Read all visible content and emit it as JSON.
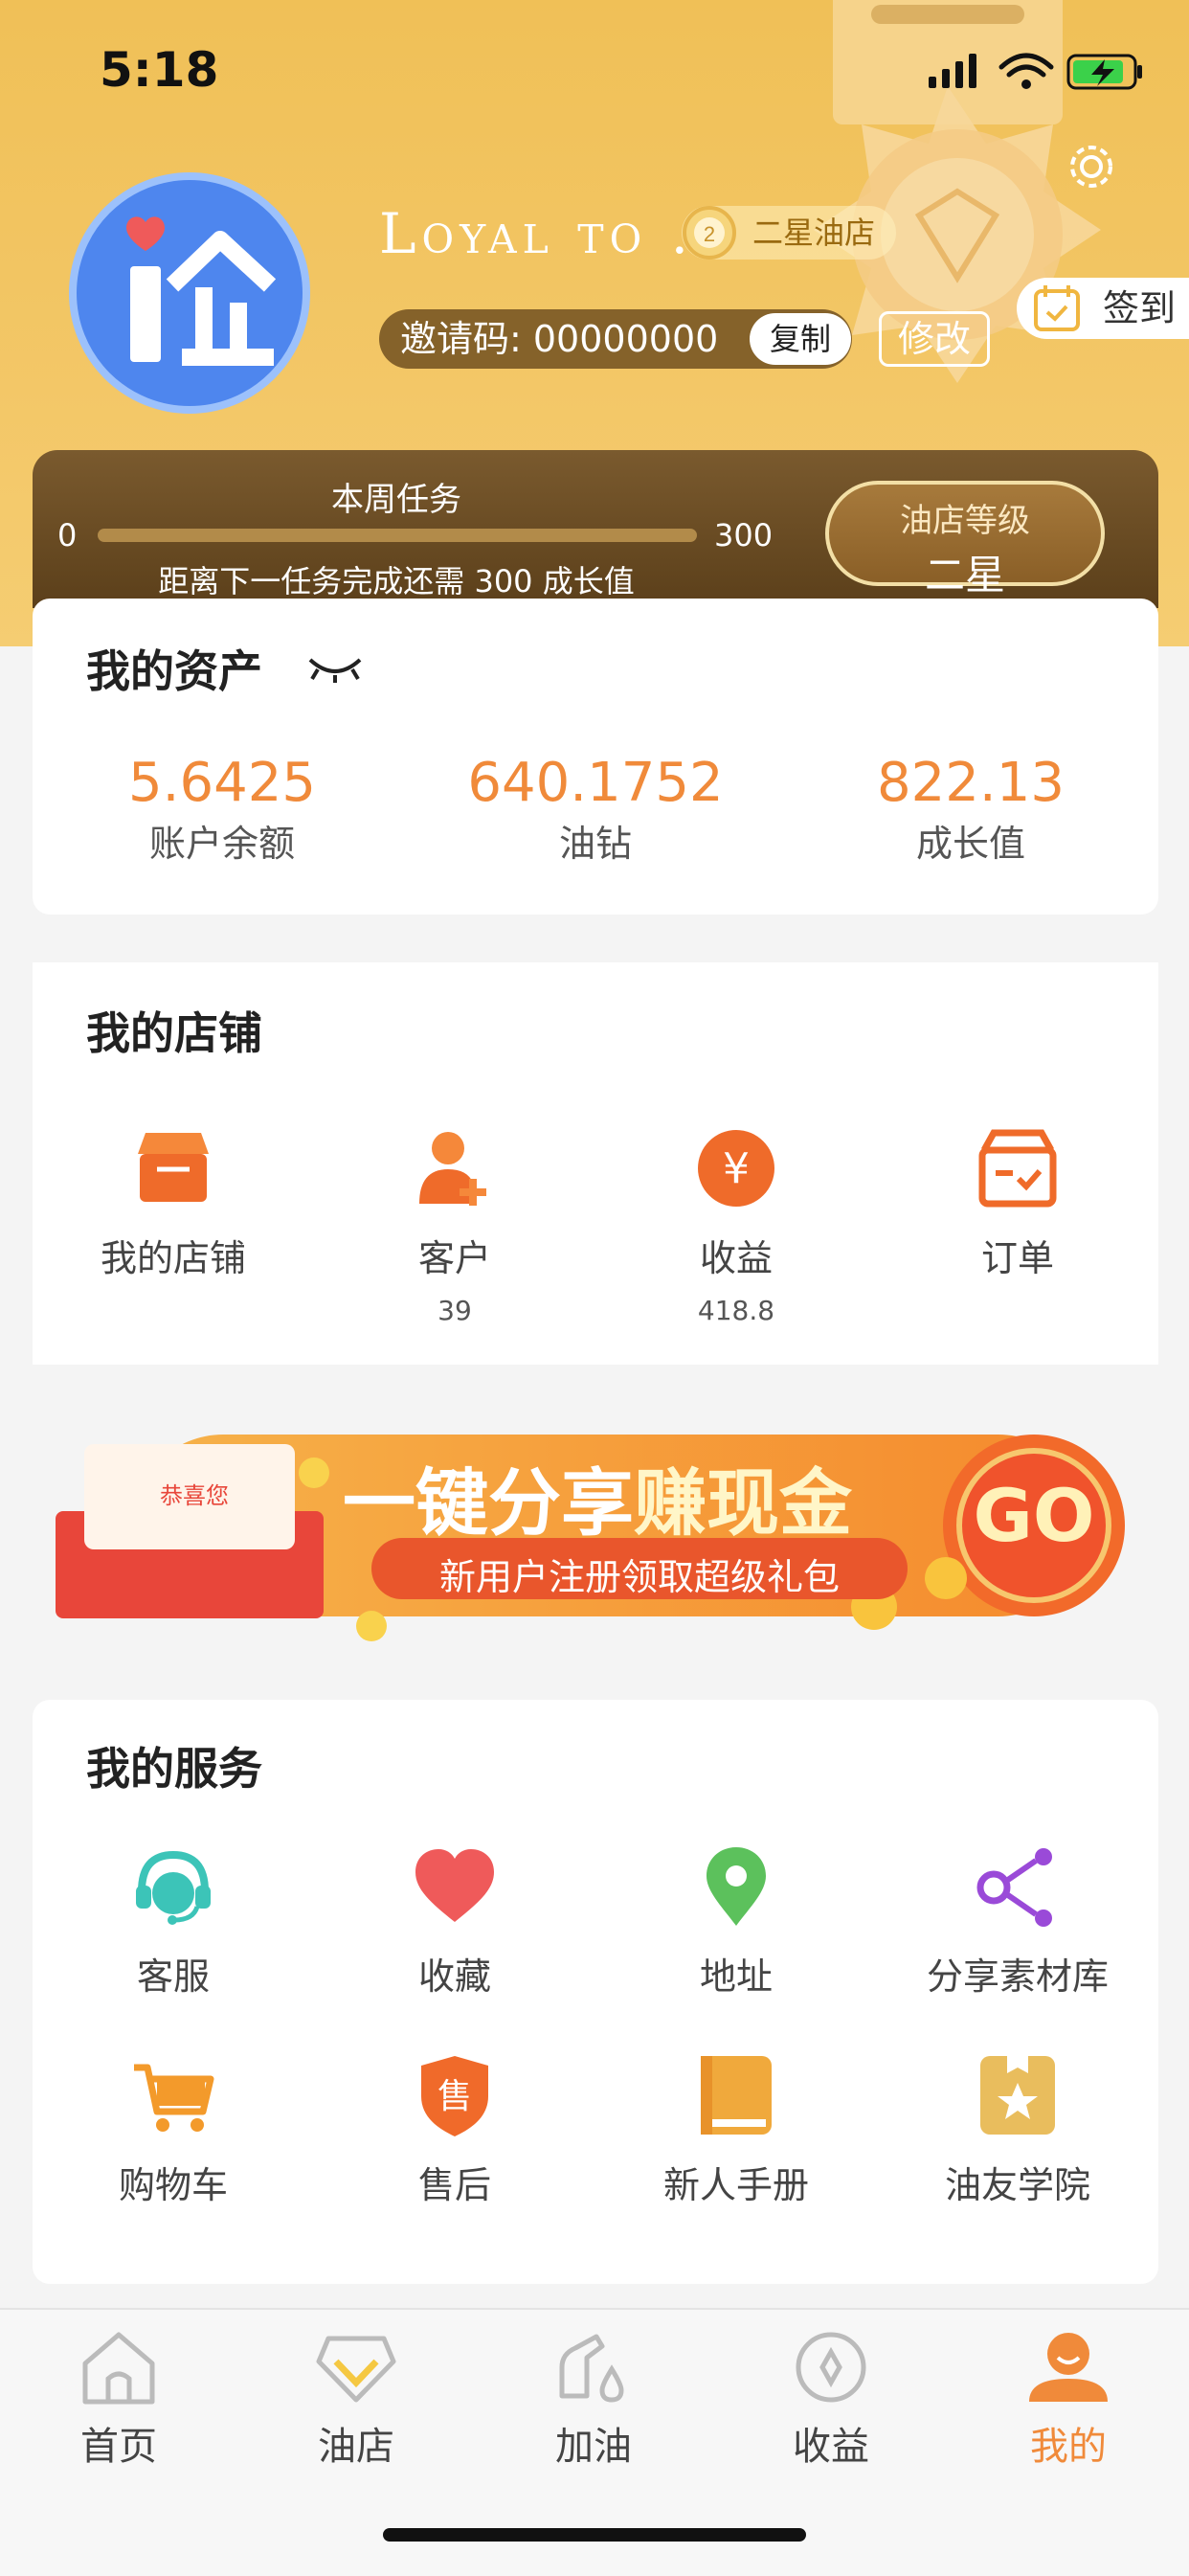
{
  "status_bar": {
    "time": "5:18"
  },
  "profile": {
    "username": "Loyal to .",
    "badge": "二星油店",
    "invite_label": "邀请码: 00000000",
    "copy_label": "复制",
    "edit_label": "修改",
    "signin_label": "签到"
  },
  "task": {
    "title": "本周任务",
    "min": "0",
    "max": "300",
    "progress": 0,
    "hint": "距离下一任务完成还需 300 成长值",
    "level_label": "油店等级",
    "level_value": "二星"
  },
  "assets": {
    "title": "我的资产",
    "items": [
      {
        "value": "5.6425",
        "label": "账户余额"
      },
      {
        "value": "640.1752",
        "label": "油钻"
      },
      {
        "value": "822.13",
        "label": "成长值"
      }
    ]
  },
  "store": {
    "title": "我的店铺",
    "items": [
      {
        "label": "我的店铺",
        "sub": "",
        "icon": "shop-icon"
      },
      {
        "label": "客户",
        "sub": "39",
        "icon": "add-customer-icon"
      },
      {
        "label": "收益",
        "sub": "418.8",
        "icon": "yen-coin-icon"
      },
      {
        "label": "订单",
        "sub": "",
        "icon": "order-box-icon"
      }
    ]
  },
  "banner": {
    "tag": "恭喜您",
    "headline_a": "一键分享",
    "headline_b": "赚现金",
    "sub": "新用户注册领取超级礼包",
    "go": "GO"
  },
  "services": {
    "title": "我的服务",
    "items": [
      {
        "label": "客服",
        "icon": "headset-icon",
        "color": "#3cc4b8"
      },
      {
        "label": "收藏",
        "icon": "heart-icon",
        "color": "#ef5a5a"
      },
      {
        "label": "地址",
        "icon": "location-pin-icon",
        "color": "#5cc15c"
      },
      {
        "label": "分享素材库",
        "icon": "share-nodes-icon",
        "color": "#9a4ad8"
      },
      {
        "label": "购物车",
        "icon": "cart-icon",
        "color": "#f39a2b"
      },
      {
        "label": "售后",
        "icon": "after-sale-shield-icon",
        "color": "#f06a2a"
      },
      {
        "label": "新人手册",
        "icon": "book-icon",
        "color": "#f0a93c"
      },
      {
        "label": "油友学院",
        "icon": "academy-star-icon",
        "color": "#e9bd5d"
      }
    ]
  },
  "tabs": [
    {
      "label": "首页",
      "icon": "home-icon",
      "active": false
    },
    {
      "label": "油店",
      "icon": "store-diamond-icon",
      "active": false
    },
    {
      "label": "加油",
      "icon": "fuel-nozzle-icon",
      "active": false
    },
    {
      "label": "收益",
      "icon": "earnings-icon",
      "active": false
    },
    {
      "label": "我的",
      "icon": "profile-icon",
      "active": true
    }
  ],
  "colors": {
    "accent": "#f08a3a",
    "header": "#f3c767",
    "active_tab": "#f08a3a"
  }
}
